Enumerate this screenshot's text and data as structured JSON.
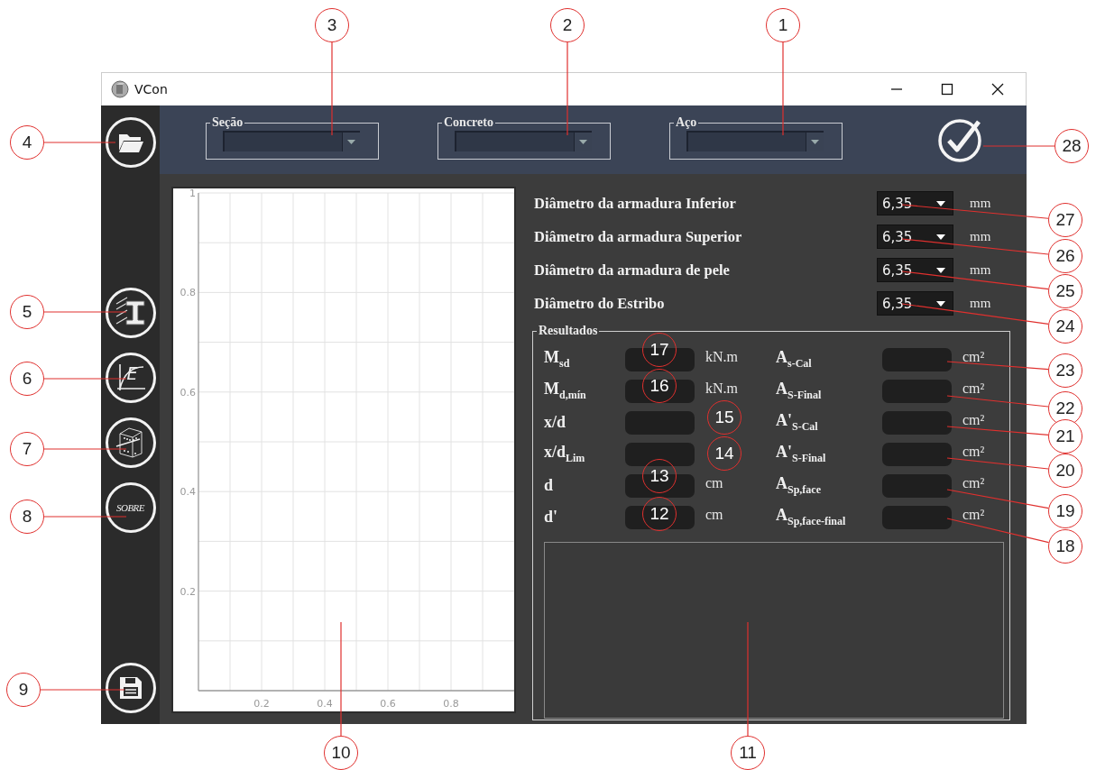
{
  "window": {
    "title": "VCon"
  },
  "sidebar": {
    "buttons": [
      {
        "kind": "open"
      },
      {
        "kind": "section"
      },
      {
        "kind": "material",
        "text": "E"
      },
      {
        "kind": "beam"
      },
      {
        "kind": "about",
        "text": "SOBRE"
      },
      {
        "kind": "save"
      }
    ]
  },
  "toolbar": {
    "selectors": [
      {
        "legend": "Seção"
      },
      {
        "legend": "Concreto"
      },
      {
        "legend": "Aço"
      }
    ]
  },
  "chart": {
    "chart_data": {
      "type": "line",
      "grid": true,
      "xlim": [
        0,
        1
      ],
      "ylim": [
        0,
        1
      ],
      "xticks": [
        0.2,
        0.4,
        0.6,
        0.8
      ],
      "yticks": [
        0.2,
        0.4,
        0.6,
        0.8,
        1
      ]
    }
  },
  "diameters": [
    {
      "label": "Diâmetro da armadura Inferior",
      "value": "6,35",
      "unit": "mm"
    },
    {
      "label": "Diâmetro da armadura Superior",
      "value": "6,35",
      "unit": "mm"
    },
    {
      "label": "Diâmetro da armadura de pele",
      "value": "6,35",
      "unit": "mm"
    },
    {
      "label": "Diâmetro do Estribo",
      "value": "6,35",
      "unit": "mm"
    }
  ],
  "results": {
    "legend": "Resultados",
    "rows": [
      {
        "left_label": "M$_{sd}$",
        "left_unit": "kN.m",
        "right_label": "A$_{s-Cal}$",
        "right_unit": "cm²"
      },
      {
        "left_label": "M$_{d,mín}$",
        "left_unit": "kN.m",
        "right_label": "A$_{S-Final}$",
        "right_unit": "cm²"
      },
      {
        "left_label": "x/d",
        "right_label": "A'$_{S-Cal}$",
        "right_unit": "cm²"
      },
      {
        "left_label": "x/d$_{Lim}$",
        "right_label": "A'$_{S-Final}$",
        "right_unit": "cm²"
      },
      {
        "left_label": "d",
        "left_unit": "cm",
        "right_label": "A$_{Sp,face}$",
        "right_unit": "cm²"
      },
      {
        "left_label": "d'",
        "left_unit": "cm",
        "right_label": "A$_{Sp,face-final}$",
        "right_unit": "cm²"
      }
    ]
  },
  "callouts": [
    {
      "label": "3"
    },
    {
      "label": "2"
    },
    {
      "label": "1"
    },
    {
      "label": "4"
    },
    {
      "label": "28"
    },
    {
      "label": "27"
    },
    {
      "label": "26"
    },
    {
      "label": "25"
    },
    {
      "label": "5"
    },
    {
      "label": "24"
    },
    {
      "label": "17"
    },
    {
      "label": "23"
    },
    {
      "label": "6"
    },
    {
      "label": "16"
    },
    {
      "label": "22"
    },
    {
      "label": "15"
    },
    {
      "label": "21"
    },
    {
      "label": "7"
    },
    {
      "label": "14"
    },
    {
      "label": "20"
    },
    {
      "label": "13"
    },
    {
      "label": "8"
    },
    {
      "label": "12"
    },
    {
      "label": "19"
    },
    {
      "label": "18"
    },
    {
      "label": "9"
    },
    {
      "label": "10"
    },
    {
      "label": "11"
    }
  ]
}
